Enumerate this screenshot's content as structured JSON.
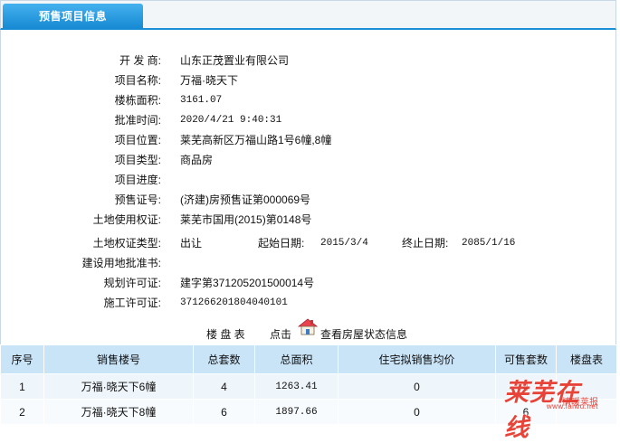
{
  "tab": {
    "label": "预售项目信息"
  },
  "info": [
    {
      "label": "开 发 商:",
      "value": "山东正茂置业有限公司"
    },
    {
      "label": "项目名称:",
      "value": "万福·晓天下"
    },
    {
      "label": "楼栋面积:",
      "value": "3161.07"
    },
    {
      "label": "批准时间:",
      "value": "2020/4/21 9:40:31"
    },
    {
      "label": "项目位置:",
      "value": "莱芜高新区万福山路1号6幢,8幢"
    },
    {
      "label": "项目类型:",
      "value": "商品房"
    },
    {
      "label": "项目进度:",
      "value": ""
    },
    {
      "label": "预售证号:",
      "value": "(济建)房预售证第000069号"
    },
    {
      "label": "土地使用权证:",
      "value": "莱芜市国用(2015)第0148号"
    },
    {
      "label": "土地权证类型:",
      "value": "出让"
    },
    {
      "label": "建设用地批准书:",
      "value": ""
    },
    {
      "label": "规划许可证:",
      "value": "建字第371205201500014号"
    },
    {
      "label": "施工许可证:",
      "value": "371266201804040101"
    }
  ],
  "land_dates": {
    "start_label": "起始日期:",
    "start_value": "2015/3/4",
    "end_label": "终止日期:",
    "end_value": "2085/1/16"
  },
  "plan": {
    "title": "楼 盘 表",
    "click": "点击",
    "link": "查看房屋状态信息"
  },
  "table": {
    "headers": [
      "序号",
      "销售楼号",
      "总套数",
      "总面积",
      "住宅拟销售均价",
      "可售套数",
      "楼盘表"
    ],
    "rows": [
      [
        "1",
        "万福·晓天下6幢",
        "4",
        "1263.41",
        "0",
        "4",
        ""
      ],
      [
        "2",
        "万福·晓天下8幢",
        "6",
        "1897.66",
        "0",
        "6",
        ""
      ]
    ]
  },
  "watermark": {
    "main": "莱芜在线",
    "sub": "情暖莱报",
    "url": "www.laiwu.net"
  },
  "colors": {
    "tab": "#1c8ed8",
    "header": "#c9e3f7",
    "watermark": "#e73a2e"
  }
}
